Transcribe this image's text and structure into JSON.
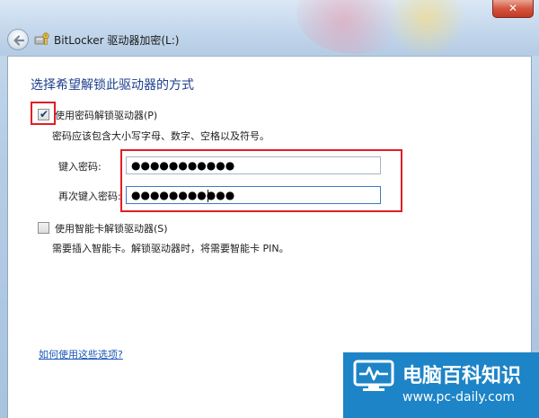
{
  "window": {
    "title": "BitLocker 驱动器加密(L:)",
    "close_glyph": "✕"
  },
  "main": {
    "heading": "选择希望解锁此驱动器的方式",
    "password_option": {
      "label": "使用密码解锁驱动器(P)",
      "checked": true,
      "hint": "密码应该包含大小写字母、数字、空格以及符号。",
      "enter_label": "键入密码:",
      "enter_value": "●●●●●●●●●●●",
      "confirm_label": "再次键入密码:",
      "confirm_value": "●●●●●●●●●●●"
    },
    "smartcard_option": {
      "label": "使用智能卡解锁驱动器(S)",
      "checked": false,
      "hint": "需要插入智能卡。解锁驱动器时，将需要智能卡 PIN。"
    },
    "help_link": "如何使用这些选项?"
  },
  "watermark": {
    "name": "电脑百科知识",
    "url": "www.pc-daily.com"
  },
  "colors": {
    "highlight": "#e21e25",
    "heading": "#1c3f8e",
    "link": "#1a56b8",
    "watermark_bg": "#1d84c7"
  },
  "icons": {
    "back": "back-arrow-icon",
    "window": "bitlocker-key-icon",
    "close": "close-icon",
    "check": "checkmark-icon",
    "logo": "monitor-pulse-icon"
  }
}
